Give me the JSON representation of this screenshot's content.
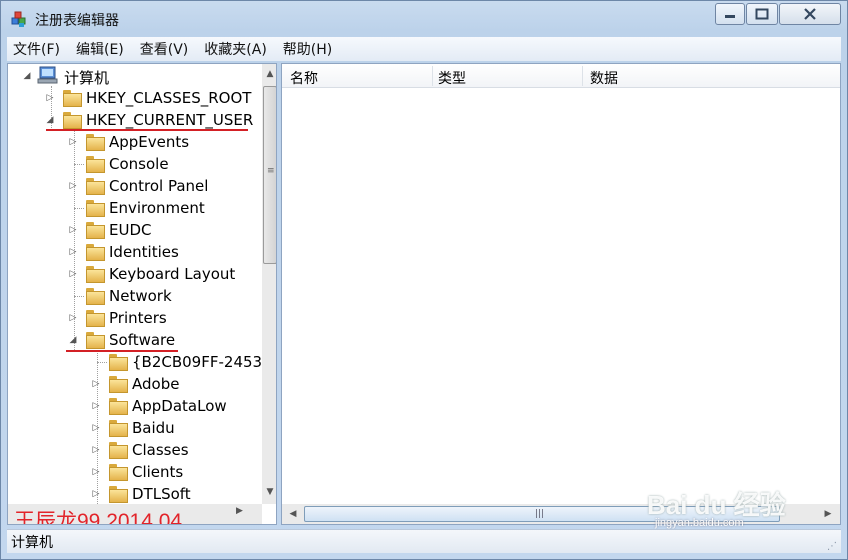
{
  "window": {
    "title": "注册表编辑器",
    "controls": {
      "minimize": "▁",
      "maximize": "□",
      "close": "✕"
    }
  },
  "menu": [
    "文件(F)",
    "编辑(E)",
    "查看(V)",
    "收藏夹(A)",
    "帮助(H)"
  ],
  "tree": {
    "root": "计算机",
    "nodes": [
      {
        "label": "HKEY_CLASSES_ROOT",
        "toggle": "▷"
      },
      {
        "label": "HKEY_CURRENT_USER",
        "toggle": "◢"
      },
      {
        "label": "AppEvents",
        "toggle": "▷"
      },
      {
        "label": "Console",
        "toggle": ""
      },
      {
        "label": "Control Panel",
        "toggle": "▷"
      },
      {
        "label": "Environment",
        "toggle": ""
      },
      {
        "label": "EUDC",
        "toggle": "▷"
      },
      {
        "label": "Identities",
        "toggle": "▷"
      },
      {
        "label": "Keyboard Layout",
        "toggle": "▷"
      },
      {
        "label": "Network",
        "toggle": ""
      },
      {
        "label": "Printers",
        "toggle": "▷"
      },
      {
        "label": "Software",
        "toggle": "◢"
      },
      {
        "label": "{B2CB09FF-2453-",
        "toggle": ""
      },
      {
        "label": "Adobe",
        "toggle": "▷"
      },
      {
        "label": "AppDataLow",
        "toggle": "▷"
      },
      {
        "label": "Baidu",
        "toggle": "▷"
      },
      {
        "label": "Classes",
        "toggle": "▷"
      },
      {
        "label": "Clients",
        "toggle": "▷"
      },
      {
        "label": "DTLSoft",
        "toggle": "▷"
      }
    ]
  },
  "list": {
    "columns": [
      "名称",
      "类型",
      "数据"
    ]
  },
  "overlay": {
    "watermark": "王辰龙99 2014.04",
    "baidu_logo": "Bai du 经验",
    "baidu_site": "jingyan.baidu.com"
  },
  "statusbar": {
    "path": "计算机"
  },
  "colors": {
    "annotation_red": "#d32025",
    "frame": "#c3d7ee"
  }
}
